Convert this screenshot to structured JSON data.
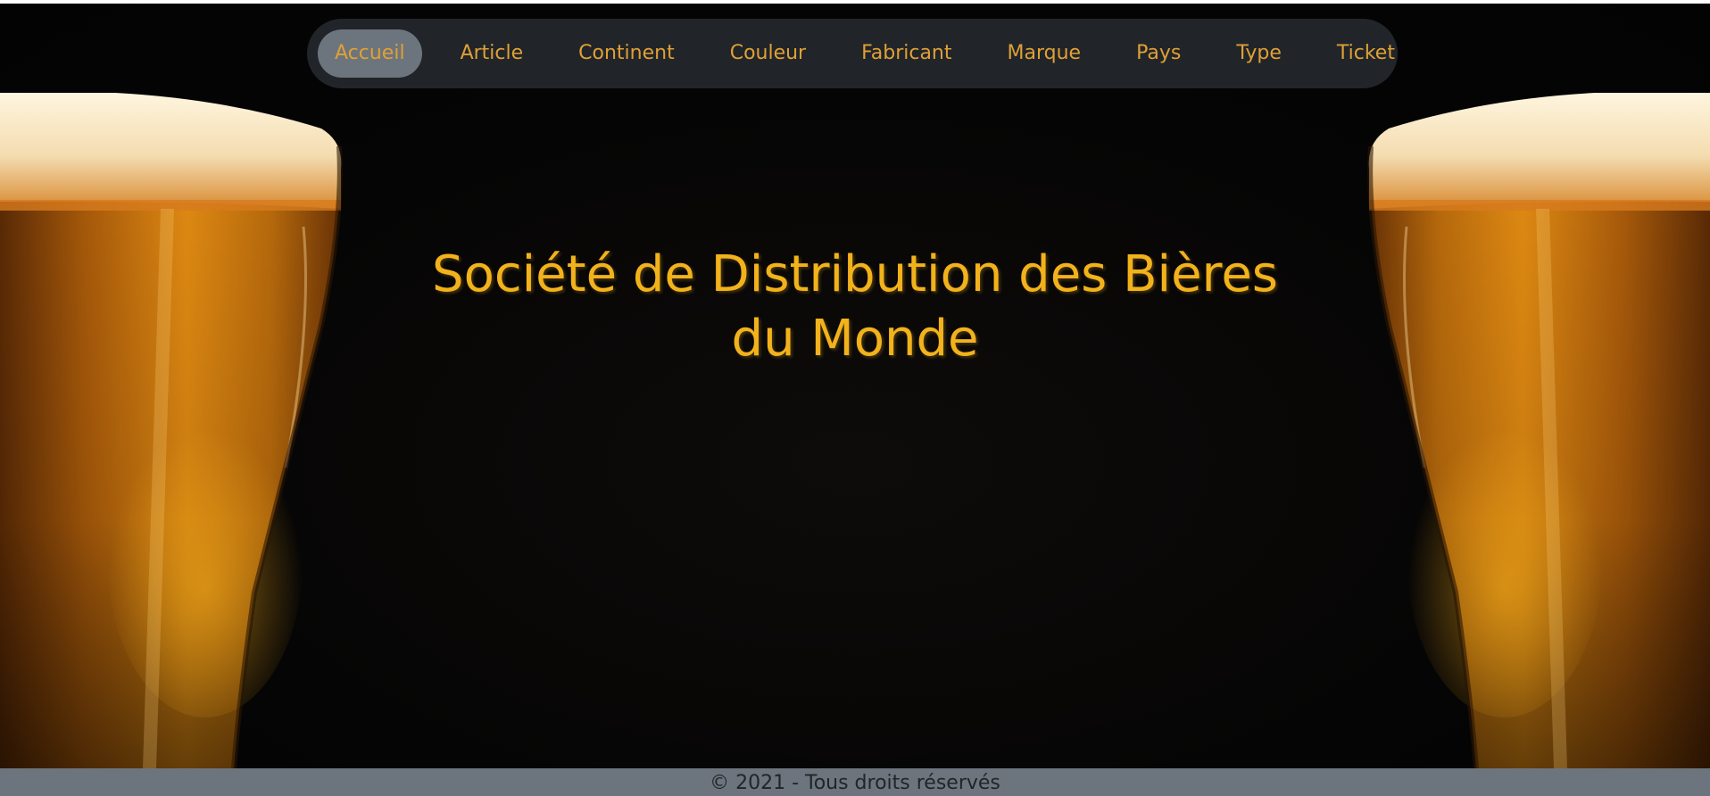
{
  "navbar": {
    "items": [
      {
        "label": "Accueil",
        "active": true
      },
      {
        "label": "Article"
      },
      {
        "label": "Continent"
      },
      {
        "label": "Couleur"
      },
      {
        "label": "Fabricant"
      },
      {
        "label": "Marque"
      },
      {
        "label": "Pays"
      },
      {
        "label": "Type"
      },
      {
        "label": "Ticket"
      }
    ]
  },
  "hero": {
    "title_line1": "Société de Distribution des Bières",
    "title_line2": "du Monde",
    "background_image": "beer-glasses"
  },
  "footer": {
    "text": "© 2021 - Tous droits réservés"
  },
  "colors": {
    "accent": "#f2b21b",
    "nav_text": "#e0a036",
    "navbar_bg": "#212529",
    "active_pill": "#6c757d",
    "footer_bg": "#6c757d"
  }
}
